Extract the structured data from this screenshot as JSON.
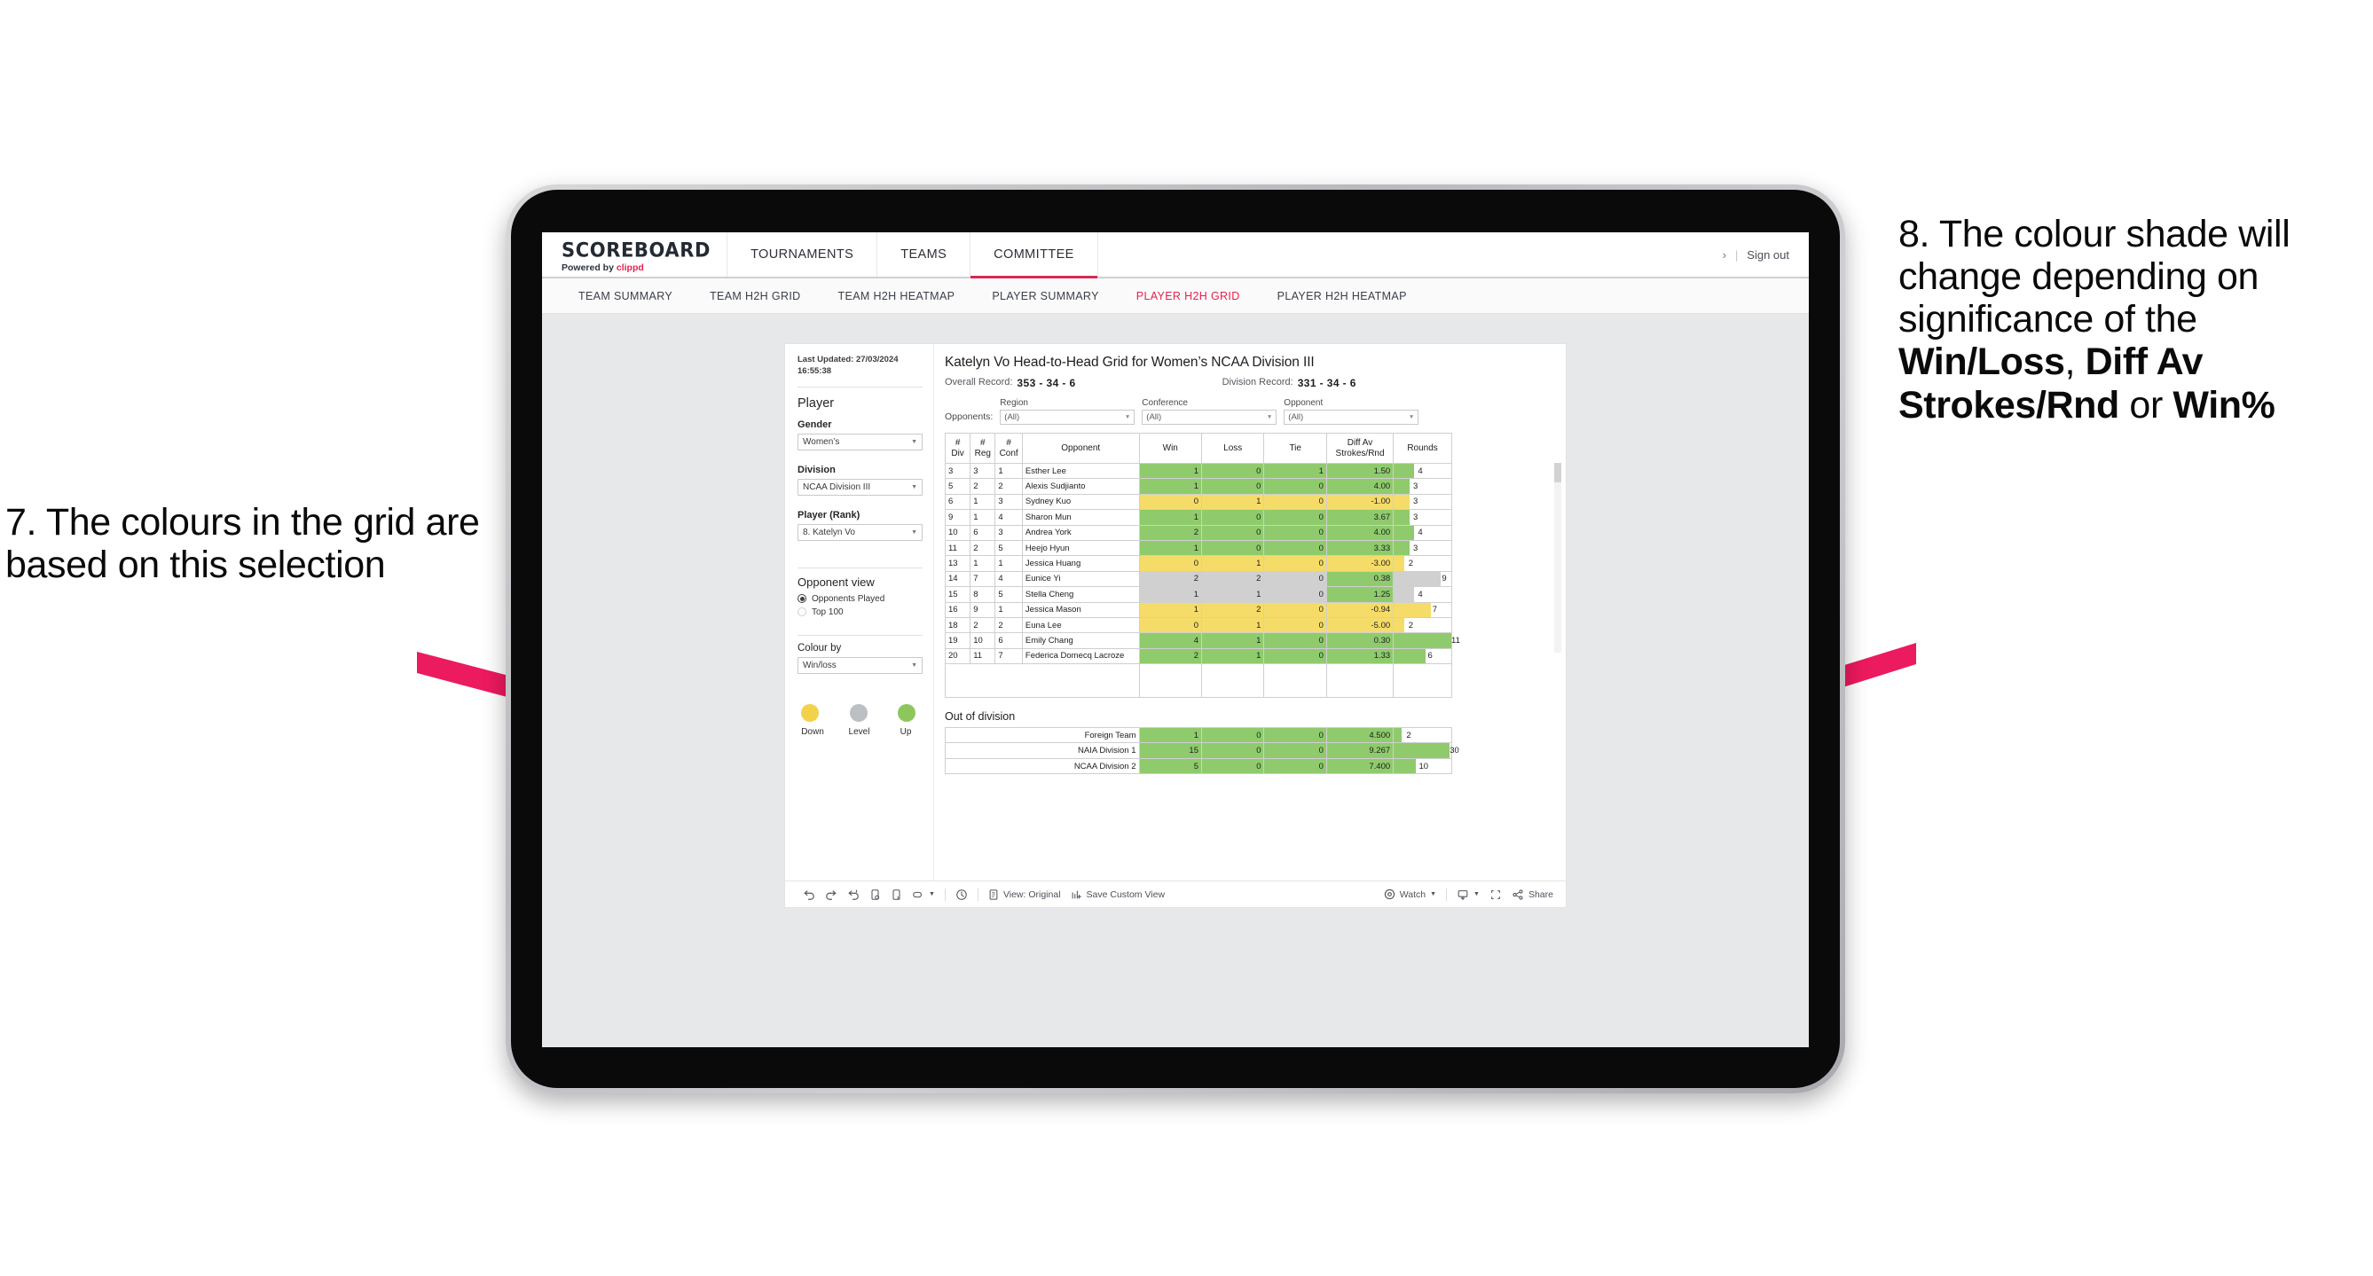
{
  "annotations": {
    "left": {
      "id": "annotation-7",
      "text": "7. The colours in the grid are based on this selection"
    },
    "right": {
      "id": "annotation-8",
      "parts": [
        {
          "text": "8. The colour shade will change depending on significance of the ",
          "bold": false
        },
        {
          "text": "Win/Loss",
          "bold": true
        },
        {
          "text": ", ",
          "bold": false
        },
        {
          "text": "Diff Av Strokes/Rnd",
          "bold": true
        },
        {
          "text": " or ",
          "bold": false
        },
        {
          "text": "Win%",
          "bold": true
        }
      ],
      "arrow_color": "#ec1a5e"
    },
    "arrow_color": "#ec1a5e"
  },
  "app": {
    "brand": {
      "title": "SCOREBOARD",
      "powered_prefix": "Powered by",
      "powered_brand": "clippd"
    },
    "top_tabs": [
      {
        "label": "TOURNAMENTS",
        "active": false
      },
      {
        "label": "TEAMS",
        "active": false
      },
      {
        "label": "COMMITTEE",
        "active": true
      }
    ],
    "top_right": {
      "chevron": "›",
      "divider": "|",
      "sign_out": "Sign out"
    },
    "sub_tabs": [
      {
        "label": "TEAM SUMMARY",
        "active": false
      },
      {
        "label": "TEAM H2H GRID",
        "active": false
      },
      {
        "label": "TEAM H2H HEATMAP",
        "active": false
      },
      {
        "label": "PLAYER SUMMARY",
        "active": false
      },
      {
        "label": "PLAYER H2H GRID",
        "active": true
      },
      {
        "label": "PLAYER H2H HEATMAP",
        "active": false
      }
    ],
    "accent_color": "#e8204f"
  },
  "sidebar": {
    "last_updated": "Last Updated: 27/03/2024 16:55:38",
    "player_heading": "Player",
    "gender": {
      "label": "Gender",
      "value": "Women’s"
    },
    "division": {
      "label": "Division",
      "value": "NCAA Division III"
    },
    "player_rank": {
      "label": "Player (Rank)",
      "value": "8. Katelyn Vo"
    },
    "opponent_view": {
      "heading": "Opponent view",
      "options": [
        {
          "label": "Opponents Played",
          "selected": true
        },
        {
          "label": "Top 100",
          "selected": false
        }
      ]
    },
    "colour_by": {
      "label": "Colour by",
      "value": "Win/loss"
    },
    "legend": {
      "items": [
        {
          "label": "Down",
          "color": "#f2d24b"
        },
        {
          "label": "Level",
          "color": "#bcc0c4"
        },
        {
          "label": "Up",
          "color": "#8dc75b"
        }
      ]
    }
  },
  "main": {
    "title": "Katelyn Vo Head-to-Head Grid for Women’s NCAA Division III",
    "overall_record": {
      "label": "Overall Record:",
      "value": "353 -  34 - 6"
    },
    "division_record": {
      "label": "Division Record:",
      "value": "331 -  34 - 6"
    },
    "opponents_label": "Opponents:",
    "filters": [
      {
        "label": "Region",
        "value": "(All)"
      },
      {
        "label": "Conference",
        "value": "(All)"
      },
      {
        "label": "Opponent",
        "value": "(All)"
      }
    ],
    "table": {
      "headers": [
        "# Div",
        "# Reg",
        "# Conf",
        "Opponent",
        "Win",
        "Loss",
        "Tie",
        "Diff Av Strokes/Rnd",
        "Rounds"
      ],
      "header_lines": [
        [
          "#",
          "Div"
        ],
        [
          "#",
          "Reg"
        ],
        [
          "#",
          "Conf"
        ],
        [
          "Opponent"
        ],
        [
          "Win"
        ],
        [
          "Loss"
        ],
        [
          "Tie"
        ],
        [
          "Diff Av",
          "Strokes/Rnd"
        ],
        [
          "Rounds"
        ]
      ],
      "rows": [
        {
          "div": "3",
          "reg": "3",
          "conf": "1",
          "opponent": "Esther Lee",
          "win": "1",
          "loss": "0",
          "tie": "1",
          "diff": "1.50",
          "rounds": "4",
          "color": "green",
          "bar_pct": 36
        },
        {
          "div": "5",
          "reg": "2",
          "conf": "2",
          "opponent": "Alexis Sudjianto",
          "win": "1",
          "loss": "0",
          "tie": "0",
          "diff": "4.00",
          "rounds": "3",
          "color": "green",
          "bar_pct": 27
        },
        {
          "div": "6",
          "reg": "1",
          "conf": "3",
          "opponent": "Sydney Kuo",
          "win": "0",
          "loss": "1",
          "tie": "0",
          "diff": "-1.00",
          "rounds": "3",
          "color": "yellow",
          "bar_pct": 27
        },
        {
          "div": "9",
          "reg": "1",
          "conf": "4",
          "opponent": "Sharon Mun",
          "win": "1",
          "loss": "0",
          "tie": "0",
          "diff": "3.67",
          "rounds": "3",
          "color": "green",
          "bar_pct": 27
        },
        {
          "div": "10",
          "reg": "6",
          "conf": "3",
          "opponent": "Andrea York",
          "win": "2",
          "loss": "0",
          "tie": "0",
          "diff": "4.00",
          "rounds": "4",
          "color": "green",
          "bar_pct": 36
        },
        {
          "div": "11",
          "reg": "2",
          "conf": "5",
          "opponent": "Heejo Hyun",
          "win": "1",
          "loss": "0",
          "tie": "0",
          "diff": "3.33",
          "rounds": "3",
          "color": "green",
          "bar_pct": 27
        },
        {
          "div": "13",
          "reg": "1",
          "conf": "1",
          "opponent": "Jessica Huang",
          "win": "0",
          "loss": "1",
          "tie": "0",
          "diff": "-3.00",
          "rounds": "2",
          "color": "yellow",
          "bar_pct": 18
        },
        {
          "div": "14",
          "reg": "7",
          "conf": "4",
          "opponent": "Eunice Yi",
          "win": "2",
          "loss": "2",
          "tie": "0",
          "diff": "0.38",
          "rounds": "9",
          "color": "grey",
          "bar_pct": 82,
          "diff_color": "green"
        },
        {
          "div": "15",
          "reg": "8",
          "conf": "5",
          "opponent": "Stella Cheng",
          "win": "1",
          "loss": "1",
          "tie": "0",
          "diff": "1.25",
          "rounds": "4",
          "color": "grey",
          "bar_pct": 36,
          "diff_color": "green"
        },
        {
          "div": "16",
          "reg": "9",
          "conf": "1",
          "opponent": "Jessica Mason",
          "win": "1",
          "loss": "2",
          "tie": "0",
          "diff": "-0.94",
          "rounds": "7",
          "color": "yellow",
          "bar_pct": 64
        },
        {
          "div": "18",
          "reg": "2",
          "conf": "2",
          "opponent": "Euna Lee",
          "win": "0",
          "loss": "1",
          "tie": "0",
          "diff": "-5.00",
          "rounds": "2",
          "color": "yellow",
          "bar_pct": 18
        },
        {
          "div": "19",
          "reg": "10",
          "conf": "6",
          "opponent": "Emily Chang",
          "win": "4",
          "loss": "1",
          "tie": "0",
          "diff": "0.30",
          "rounds": "11",
          "color": "green",
          "bar_pct": 100
        },
        {
          "div": "20",
          "reg": "11",
          "conf": "7",
          "opponent": "Federica Domecq Lacroze",
          "win": "2",
          "loss": "1",
          "tie": "0",
          "diff": "1.33",
          "rounds": "6",
          "color": "green",
          "bar_pct": 55
        }
      ]
    },
    "out_of_division": {
      "title": "Out of division",
      "rows": [
        {
          "name": "Foreign Team",
          "win": "1",
          "loss": "0",
          "tie": "0",
          "diff": "4.500",
          "rounds": "2",
          "color": "green",
          "bar_pct": 14
        },
        {
          "name": "NAIA Division 1",
          "win": "15",
          "loss": "0",
          "tie": "0",
          "diff": "9.267",
          "rounds": "30",
          "color": "green",
          "bar_pct": 97
        },
        {
          "name": "NCAA Division 2",
          "win": "5",
          "loss": "0",
          "tie": "0",
          "diff": "7.400",
          "rounds": "10",
          "color": "green",
          "bar_pct": 38
        }
      ]
    },
    "cell_colors": {
      "green": "#8fcb6d",
      "yellow": "#f5dc68",
      "grey": "#d0d0d0",
      "white": "#ffffff"
    }
  },
  "viz_toolbar": {
    "items": [
      {
        "name": "undo-icon",
        "label": ""
      },
      {
        "name": "redo-icon",
        "label": ""
      },
      {
        "name": "revert-icon",
        "label": ""
      },
      {
        "name": "refresh-data-icon",
        "label": ""
      },
      {
        "name": "pause-updates-icon",
        "label": ""
      },
      {
        "name": "highlight-icon",
        "label": "",
        "caret": true
      },
      {
        "name": "alerts-icon",
        "label": ""
      },
      {
        "name": "view-original-icon",
        "label": "View: Original"
      },
      {
        "name": "save-custom-view-icon",
        "label": "Save Custom View"
      },
      {
        "name": "watch-icon",
        "label": "Watch",
        "caret": true
      },
      {
        "name": "download-icon",
        "label": "",
        "caret": true
      },
      {
        "name": "fullscreen-icon",
        "label": ""
      },
      {
        "name": "share-icon",
        "label": "Share"
      }
    ]
  }
}
